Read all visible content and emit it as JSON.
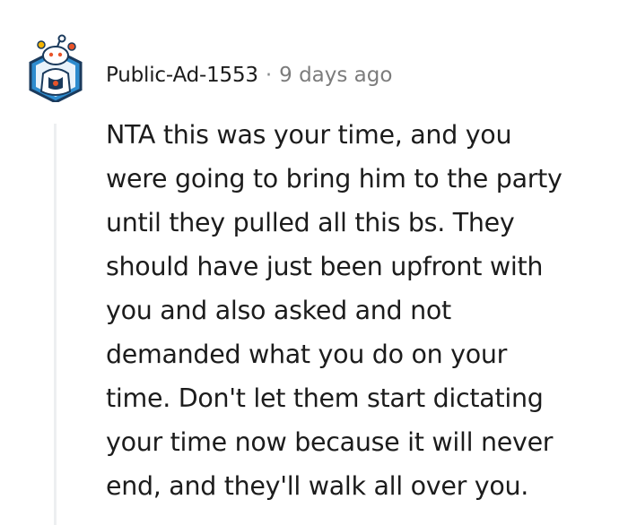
{
  "comment": {
    "author": "Public-Ad-1553",
    "separator": "·",
    "timestamp": "9 days ago",
    "avatar_icon": "snoo-avatar-icon",
    "body_lines": [
      "NTA this was your time, and you",
      "were going to bring him to the party",
      "until they pulled all this bs. They",
      "should have just been upfront with",
      "you and also asked and not",
      "demanded what you do on your",
      "time. Don't let them start dictating",
      "your time now because it will never",
      "end, and they'll walk all over you."
    ]
  },
  "colors": {
    "text": "#1c1c1c",
    "meta": "#7c7c7c",
    "thread_line": "#edeff1",
    "avatar_blue": "#2d8ccf",
    "avatar_dark": "#1a3a5c"
  }
}
